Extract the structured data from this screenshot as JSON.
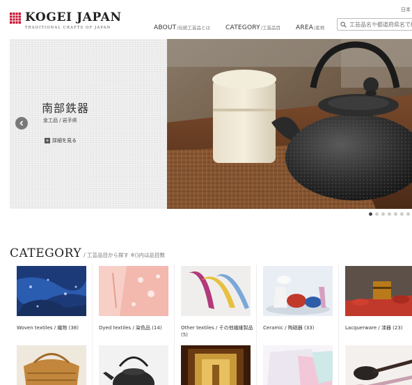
{
  "header": {
    "logo_title": "KOGEI JAPAN",
    "logo_subtitle": "TRADITIONAL CRAFTS OF JAPAN",
    "lang": "日本",
    "nav": [
      {
        "en": "ABOUT",
        "ja": "/伝統工芸品とは"
      },
      {
        "en": "CATEGORY",
        "ja": "/工芸品目"
      },
      {
        "en": "AREA",
        "ja": "/産地"
      }
    ],
    "search_placeholder": "工芸品名や都道府県名で検"
  },
  "hero": {
    "title": "南部鉄器",
    "subtitle": "金工品 / 岩手県",
    "more_label": "詳細を見る",
    "slides": 7,
    "active_slide": 1
  },
  "category": {
    "title": "CATEGORY",
    "subtitle": "/ 工芸品目から探す ※()内は品目数",
    "items": [
      {
        "label": "Woven textiles / 織物 (38)"
      },
      {
        "label": "Dyed textiles / 染色品 (14)"
      },
      {
        "label": "Other textiles / その他繊維製品 (5)"
      },
      {
        "label": "Ceramic / 陶磁器 (33)"
      },
      {
        "label": "Lacquerware / 漆器 (23)"
      },
      {
        "label": ""
      },
      {
        "label": ""
      },
      {
        "label": ""
      },
      {
        "label": ""
      },
      {
        "label": ""
      }
    ]
  },
  "colors": {
    "logo_red": "#c8102e",
    "text_dark": "#222222",
    "muted": "#777777"
  }
}
